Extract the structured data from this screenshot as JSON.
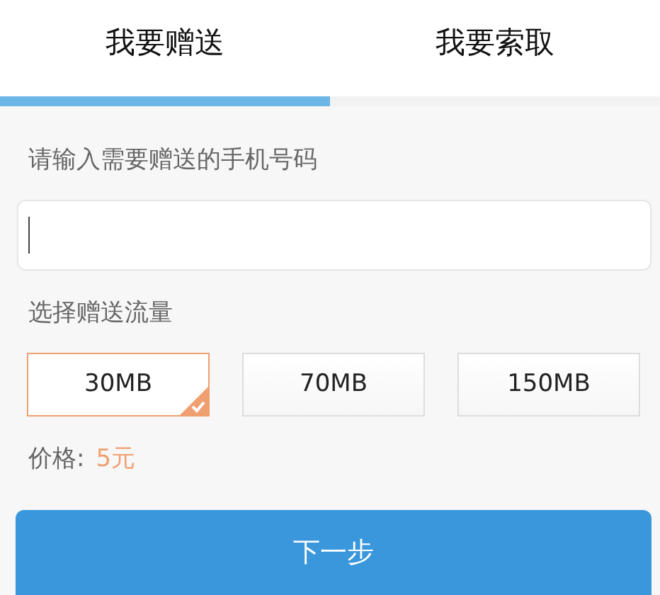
{
  "tabs": [
    {
      "label": "我要赠送",
      "selected": true
    },
    {
      "label": "我要索取",
      "selected": false
    }
  ],
  "phone_label": "请输入需要赠送的手机号码",
  "amount_label": "选择赠送流量",
  "options": [
    {
      "label": "30MB",
      "selected": true
    },
    {
      "label": "70MB",
      "selected": false
    },
    {
      "label": "150MB",
      "selected": false
    }
  ],
  "price": {
    "label": "价格:",
    "value": "5元"
  },
  "next_button": "下一步"
}
